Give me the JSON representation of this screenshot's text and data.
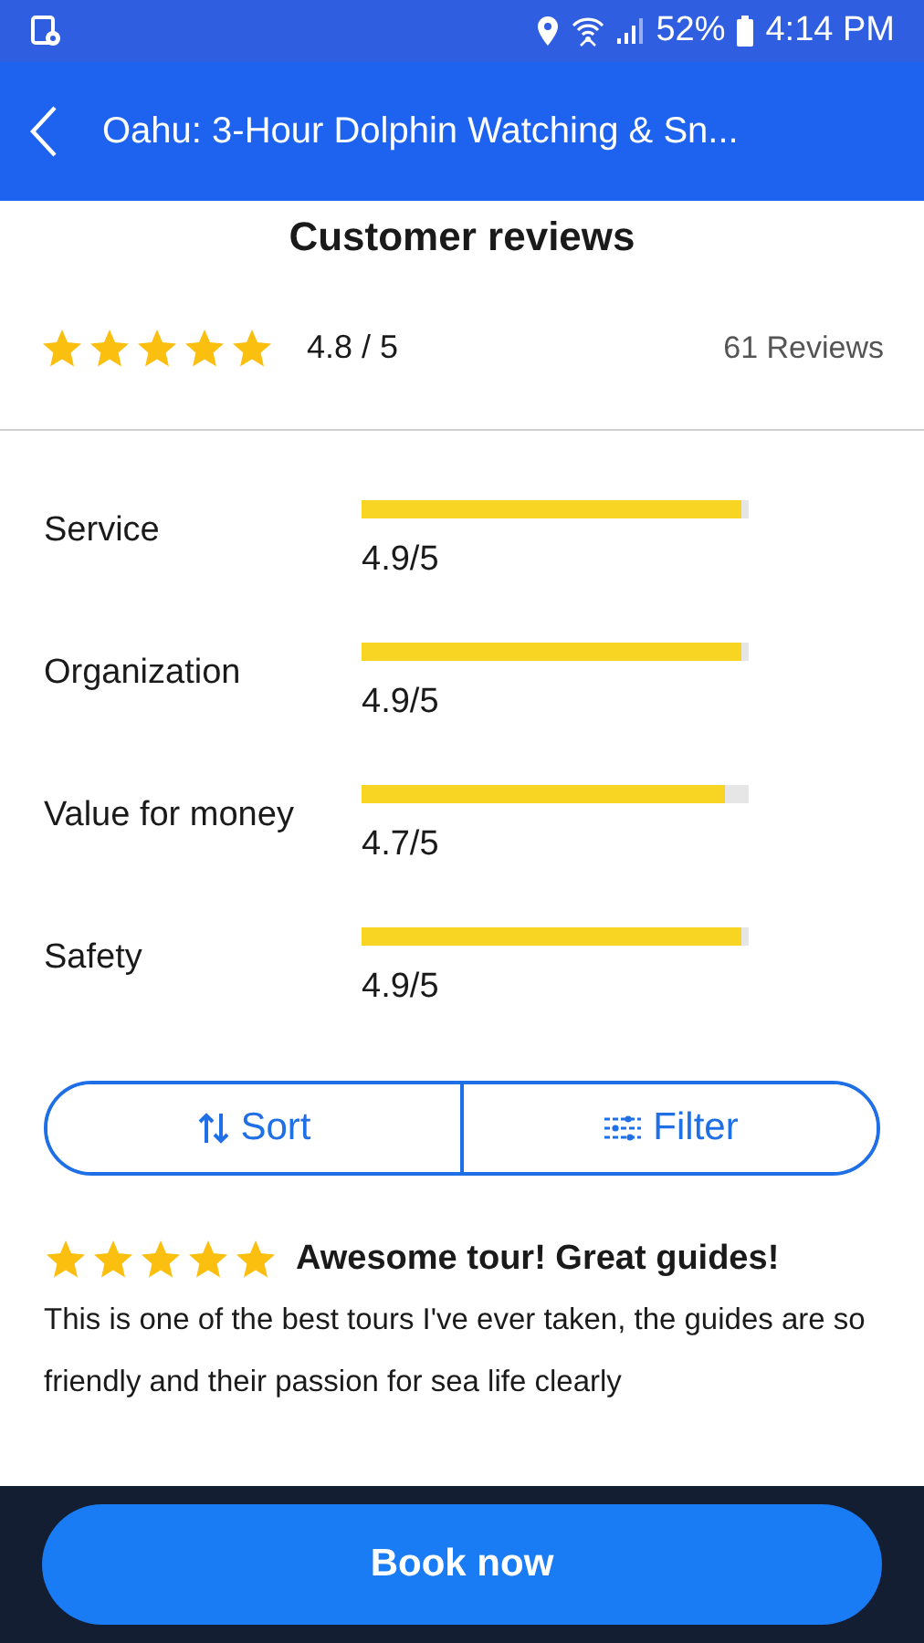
{
  "status_bar": {
    "battery": "52%",
    "time": "4:14 PM"
  },
  "app_bar": {
    "title": "Oahu: 3-Hour Dolphin Watching & Sn..."
  },
  "summary": {
    "heading": "Customer reviews",
    "stars": 5,
    "score": "4.8 / 5",
    "count": "61 Reviews"
  },
  "categories": [
    {
      "label": "Service",
      "level": 0.98,
      "reading": "4.9/5"
    },
    {
      "label": "Organization",
      "level": 0.98,
      "reading": "4.9/5"
    },
    {
      "label": "Value for money",
      "level": 0.94,
      "reading": "4.7/5"
    },
    {
      "label": "Safety",
      "level": 0.98,
      "reading": "4.9/5"
    }
  ],
  "actions": [
    {
      "kind": "sort",
      "label": "Sort"
    },
    {
      "kind": "filter",
      "label": "Filter"
    }
  ],
  "review": {
    "stars": 5,
    "title": "Awesome tour! Great guides!",
    "text": "This is one of the best tours I've ever taken, the guides are so friendly and their passion for sea life clearly"
  },
  "book_button": "Book now"
}
